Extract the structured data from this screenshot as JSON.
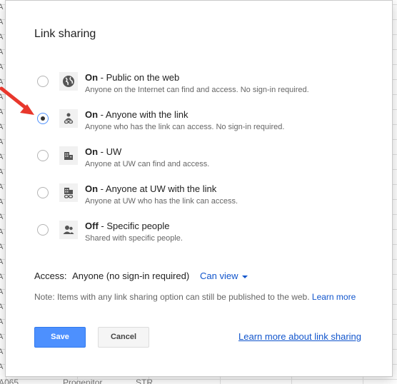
{
  "dialog": {
    "title": "Link sharing",
    "options": [
      {
        "bold": "On",
        "title_rest": " - Public on the web",
        "description": "Anyone on the Internet can find and access. No sign-in required.",
        "icon": "globe-icon",
        "selected": false
      },
      {
        "bold": "On",
        "title_rest": " - Anyone with the link",
        "description": "Anyone who has the link can access. No sign-in required.",
        "icon": "person-link-icon",
        "selected": true
      },
      {
        "bold": "On",
        "title_rest": " - UW",
        "description": "Anyone at UW can find and access.",
        "icon": "building-icon",
        "selected": false
      },
      {
        "bold": "On",
        "title_rest": " - Anyone at UW with the link",
        "description": "Anyone at UW who has the link can access.",
        "icon": "building-link-icon",
        "selected": false
      },
      {
        "bold": "Off",
        "title_rest": " - Specific people",
        "description": "Shared with specific people.",
        "icon": "people-icon",
        "selected": false
      }
    ],
    "access": {
      "label": "Access:",
      "value": "Anyone (no sign-in required)",
      "permission": "Can view"
    },
    "note": {
      "text": "Note: Items with any link sharing option can still be published to the web.",
      "link": "Learn more"
    },
    "buttons": {
      "save": "Save",
      "cancel": "Cancel"
    },
    "learn_more_link": "Learn more about link sharing"
  },
  "background": {
    "row_letters": [
      "A",
      "A",
      "A",
      "A",
      "A",
      "A",
      "A",
      "A",
      "A",
      "A",
      "A",
      "A",
      "A",
      "A",
      "A",
      "A",
      "A",
      "A",
      "A",
      "A",
      "A",
      "A",
      "A",
      "A",
      "A"
    ],
    "bottom_row": [
      "A065",
      "Progenitor",
      "STR"
    ]
  },
  "colors": {
    "accent": "#4d90fe",
    "link": "#1155cc",
    "annotation": "#e8372c"
  }
}
